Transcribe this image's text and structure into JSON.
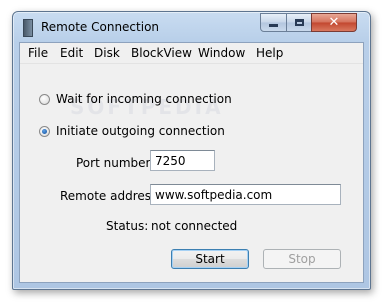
{
  "window": {
    "title": "Remote Connection",
    "close_glyph": "✕"
  },
  "menu": [
    "File",
    "Edit",
    "Disk",
    "BlockView",
    "Window",
    "Help"
  ],
  "options": {
    "wait_label": "Wait for incoming connection",
    "initiate_label": "Initiate outgoing connection",
    "selected": "initiate"
  },
  "fields": {
    "port_label": "Port number:",
    "port_value": "7250",
    "address_label": "Remote address:",
    "address_value": "www.softpedia.com"
  },
  "status": {
    "label": "Status:",
    "value": "not connected"
  },
  "buttons": {
    "start": "Start",
    "stop": "Stop"
  },
  "watermark": "SOFTPEDIA"
}
